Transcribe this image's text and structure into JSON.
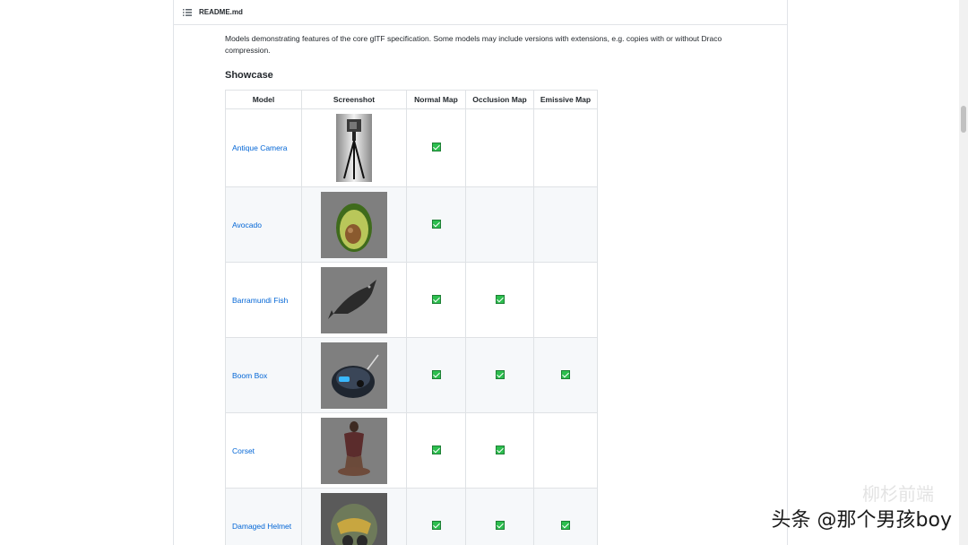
{
  "file": {
    "name": "README.md",
    "icon": "list-icon"
  },
  "intro": "Models demonstrating features of the core glTF specification. Some models may include versions with extensions, e.g. copies with or without Draco compression.",
  "section_title": "Showcase",
  "table": {
    "headers": [
      "Model",
      "Screenshot",
      "Normal Map",
      "Occlusion Map",
      "Emissive Map"
    ],
    "rows": [
      {
        "name": "Antique Camera",
        "normal": true,
        "occlusion": false,
        "emissive": false
      },
      {
        "name": "Avocado",
        "normal": true,
        "occlusion": false,
        "emissive": false
      },
      {
        "name": "Barramundi Fish",
        "normal": true,
        "occlusion": true,
        "emissive": false
      },
      {
        "name": "Boom Box",
        "normal": true,
        "occlusion": true,
        "emissive": true
      },
      {
        "name": "Corset",
        "normal": true,
        "occlusion": true,
        "emissive": false
      },
      {
        "name": "Damaged Helmet",
        "normal": true,
        "occlusion": true,
        "emissive": true
      }
    ]
  },
  "colors": {
    "link": "#0366d6",
    "check": "#2cbe4e",
    "border": "#dfe2e5"
  },
  "watermark": {
    "text": "头条 @那个男孩boy",
    "faint": "柳杉前端"
  }
}
